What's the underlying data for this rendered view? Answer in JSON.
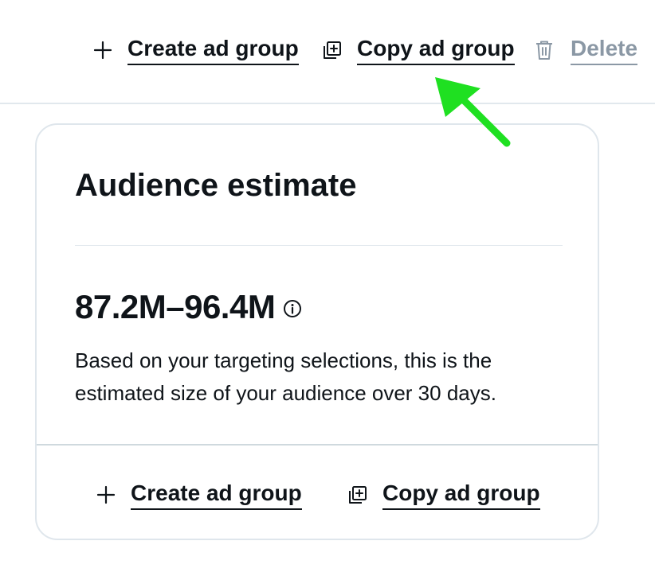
{
  "toolbar": {
    "create_label": "Create ad group",
    "copy_label": "Copy ad group",
    "delete_label": "Delete"
  },
  "card": {
    "title": "Audience estimate",
    "estimate": "87.2M–96.4M",
    "description": "Based on your targeting selections, this is the estimated size of your audience over 30 days.",
    "footer": {
      "create_label": "Create ad group",
      "copy_label": "Copy ad group"
    }
  },
  "icons": {
    "create": "plus-icon",
    "copy": "copy-icon",
    "delete": "trash-icon",
    "info": "info-icon"
  },
  "colors": {
    "text": "#0f1419",
    "disabled": "#8b98a5",
    "border": "#dfe6ec",
    "annotation_arrow": "#1fe021"
  }
}
